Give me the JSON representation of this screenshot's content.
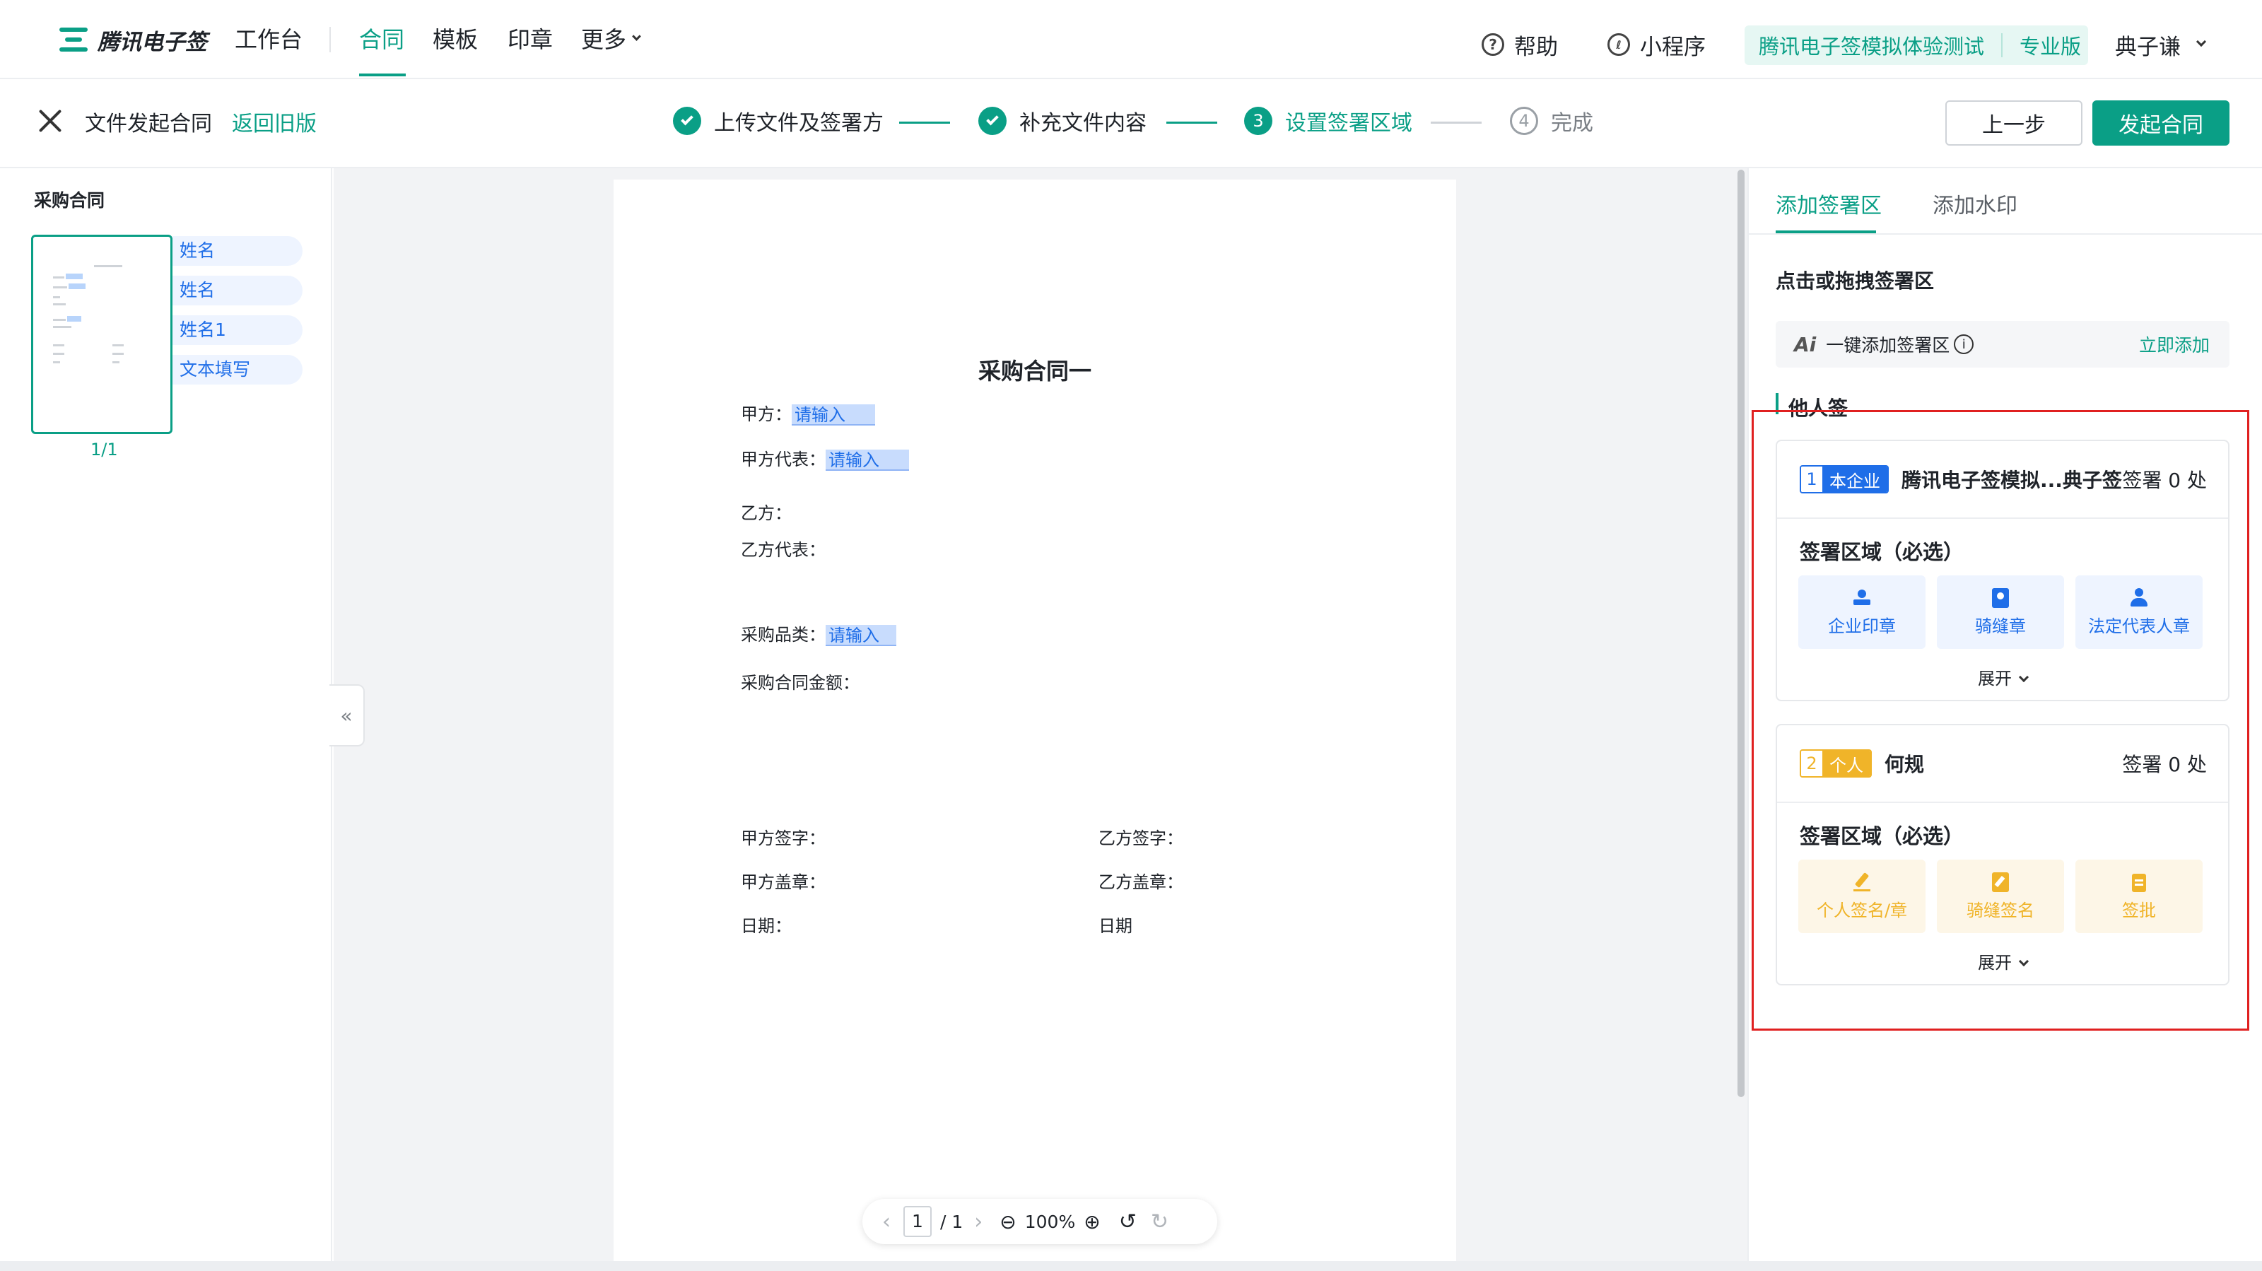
{
  "topnav": {
    "brand": "腾讯电子签",
    "items": [
      "工作台",
      "合同",
      "模板",
      "印章",
      "更多"
    ],
    "active": "合同",
    "help": "帮助",
    "mini_program": "小程序",
    "org_name": "腾讯电子签模拟体验测试",
    "edition": "专业版",
    "user": "典子谦"
  },
  "subbar": {
    "page_label": "文件发起合同",
    "back_old": "返回旧版",
    "steps": [
      {
        "num": "1",
        "label": "上传文件及签署方",
        "state": "done"
      },
      {
        "num": "2",
        "label": "补充文件内容",
        "state": "done"
      },
      {
        "num": "3",
        "label": "设置签署区域",
        "state": "current"
      },
      {
        "num": "4",
        "label": "完成",
        "state": "todo"
      }
    ],
    "prev_button": "上一步",
    "start_button": "发起合同"
  },
  "leftpanel": {
    "doc_title": "采购合同",
    "page_indicator": "1/1",
    "fields": [
      "姓名",
      "姓名",
      "姓名1",
      "文本填写"
    ]
  },
  "document": {
    "title": "采购合同一",
    "party_a_label": "甲方：",
    "party_a_rep_label": "甲方代表：",
    "party_b_label": "乙方：",
    "party_b_rep_label": "乙方代表：",
    "category_label": "采购品类：",
    "amount_label": "采购合同金额：",
    "input_placeholder": "请输入",
    "party_a_sign": "甲方签字：",
    "party_b_sign": "乙方签字：",
    "party_a_seal": "甲方盖章：",
    "party_b_seal": "乙方盖章：",
    "date_a": "日期：",
    "date_b": "日期"
  },
  "zoombar": {
    "page_current": "1",
    "page_total": "/ 1",
    "zoom": "100%"
  },
  "rightpanel": {
    "tabs": [
      "添加签署区",
      "添加水印"
    ],
    "active_tab": "添加签署区",
    "drag_title": "点击或拖拽签署区",
    "ai_label": "一键添加签署区",
    "ai_prefix": "Ai",
    "ai_action": "立即添加",
    "others_label": "他人签",
    "cards": [
      {
        "num": "1",
        "tag": "本企业",
        "party": "腾讯电子签模拟...典子签",
        "count": "签署 0 处",
        "section": "签署区域（必选）",
        "buttons": [
          "企业印章",
          "骑缝章",
          "法定代表人章"
        ],
        "expand": "展开"
      },
      {
        "num": "2",
        "tag": "个人",
        "party": "何规",
        "count": "签署 0 处",
        "section": "签署区域（必选）",
        "buttons": [
          "个人签名/章",
          "骑缝签名",
          "签批"
        ],
        "expand": "展开"
      }
    ]
  },
  "colors": {
    "accent": "#0a9f86",
    "enterprise_blue": "#1f6ee8",
    "personal_amber": "#f0b429",
    "highlight_red": "#e02020"
  }
}
